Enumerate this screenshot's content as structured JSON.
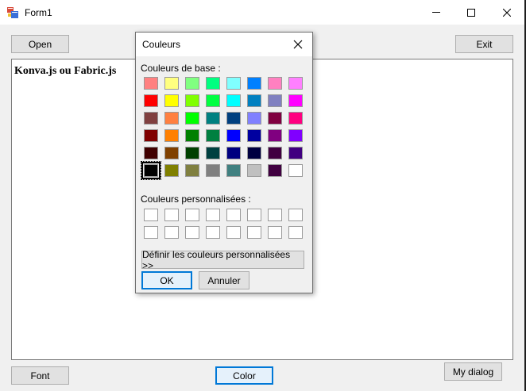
{
  "window": {
    "title": "Form1",
    "icon": "form-app-icon"
  },
  "toolbar": {
    "open_label": "Open",
    "exit_label": "Exit"
  },
  "editor": {
    "text": "Konva.js ou Fabric.js"
  },
  "bottom_bar": {
    "font_label": "Font",
    "color_label": "Color",
    "mydialog_label": "My dialog"
  },
  "color_dialog": {
    "title": "Couleurs",
    "basic_colors_label": "Couleurs de base :",
    "custom_colors_label": "Couleurs personnalisées :",
    "define_custom_label": "Définir les couleurs personnalisées >>",
    "ok_label": "OK",
    "cancel_label": "Annuler",
    "selected_color": "#000000",
    "basic_colors": [
      [
        "#ff8080",
        "#ffff80",
        "#80ff80",
        "#00ff80",
        "#80ffff",
        "#0080ff",
        "#ff80c0",
        "#ff80ff"
      ],
      [
        "#ff0000",
        "#ffff00",
        "#80ff00",
        "#00ff40",
        "#00ffff",
        "#0080c0",
        "#8080c0",
        "#ff00ff"
      ],
      [
        "#804040",
        "#ff8040",
        "#00ff00",
        "#008080",
        "#004080",
        "#8080ff",
        "#800040",
        "#ff0080"
      ],
      [
        "#800000",
        "#ff8000",
        "#008000",
        "#008040",
        "#0000ff",
        "#0000a0",
        "#800080",
        "#8000ff"
      ],
      [
        "#400000",
        "#804000",
        "#004000",
        "#004040",
        "#000080",
        "#000040",
        "#400040",
        "#400080"
      ],
      [
        "#000000",
        "#808000",
        "#808040",
        "#808080",
        "#408080",
        "#c0c0c0",
        "#400040",
        "#ffffff"
      ]
    ],
    "custom_colors": [
      [
        "#ffffff",
        "#ffffff",
        "#ffffff",
        "#ffffff",
        "#ffffff",
        "#ffffff",
        "#ffffff",
        "#ffffff"
      ],
      [
        "#ffffff",
        "#ffffff",
        "#ffffff",
        "#ffffff",
        "#ffffff",
        "#ffffff",
        "#ffffff",
        "#ffffff"
      ]
    ]
  }
}
